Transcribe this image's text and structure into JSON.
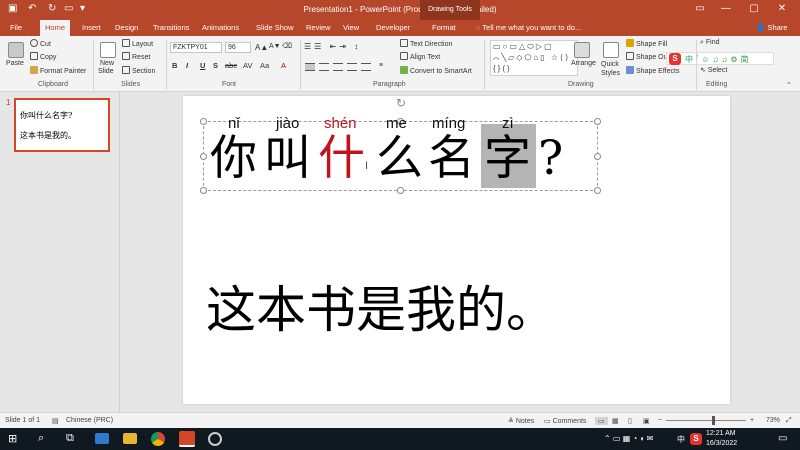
{
  "window": {
    "title": "Presentation1 - PowerPoint (Product Activation Failed)",
    "contextual_label": "Drawing Tools",
    "share": "Share"
  },
  "tabs": [
    "File",
    "Home",
    "Insert",
    "Design",
    "Transitions",
    "Animations",
    "Slide Show",
    "Review",
    "View",
    "Developer",
    "Format"
  ],
  "tell_me": "Tell me what you want to do...",
  "ribbon": {
    "clipboard": {
      "paste": "Paste",
      "cut": "Cut",
      "copy": "Copy",
      "format_painter": "Format Painter",
      "label": "Clipboard"
    },
    "slides": {
      "new_slide": "New",
      "new_slide2": "Slide",
      "layout": "Layout",
      "reset": "Reset",
      "section": "Section",
      "label": "Slides"
    },
    "font": {
      "name": "FZKTPY01",
      "size": "96",
      "bold": "B",
      "italic": "I",
      "underline": "U",
      "shadow": "S",
      "strike": "abc",
      "spacing": "AV",
      "case": "Aa",
      "label": "Font"
    },
    "paragraph": {
      "text_direction": "Text Direction",
      "align_text": "Align Text",
      "smartart": "Convert to SmartArt",
      "label": "Paragraph"
    },
    "drawing": {
      "arrange": "Arrange",
      "quick_styles": "Quick Styles",
      "shape_fill": "Shape Fill",
      "shape_outline": "Shape Out",
      "shape_effects": "Shape Effects",
      "label": "Drawing"
    },
    "editing": {
      "find": "Find",
      "select": "Select",
      "label": "Editing"
    }
  },
  "thumbnail": {
    "number": "1",
    "line1": "你叫什么名字?",
    "line2": "这本书是我的。"
  },
  "slide": {
    "pinyin": [
      "nǐ",
      "jiào",
      "shén",
      "me",
      "míng",
      "zì"
    ],
    "hanzi": [
      "你",
      "叫",
      "什",
      "么",
      "名",
      "字",
      "?"
    ],
    "sentence2": "这本书是我的。"
  },
  "status": {
    "slide_info": "Slide 1 of 1",
    "language": "Chinese (PRC)",
    "notes": "Notes",
    "comments": "Comments",
    "zoom": "73%"
  },
  "taskbar": {
    "time": "12:21 AM",
    "date": "16/3/2022",
    "ime": "中"
  },
  "colors": {
    "brand": "#b7472a",
    "highlight_text": "#c0141c",
    "selection_highlight": "#b4b4b4"
  }
}
